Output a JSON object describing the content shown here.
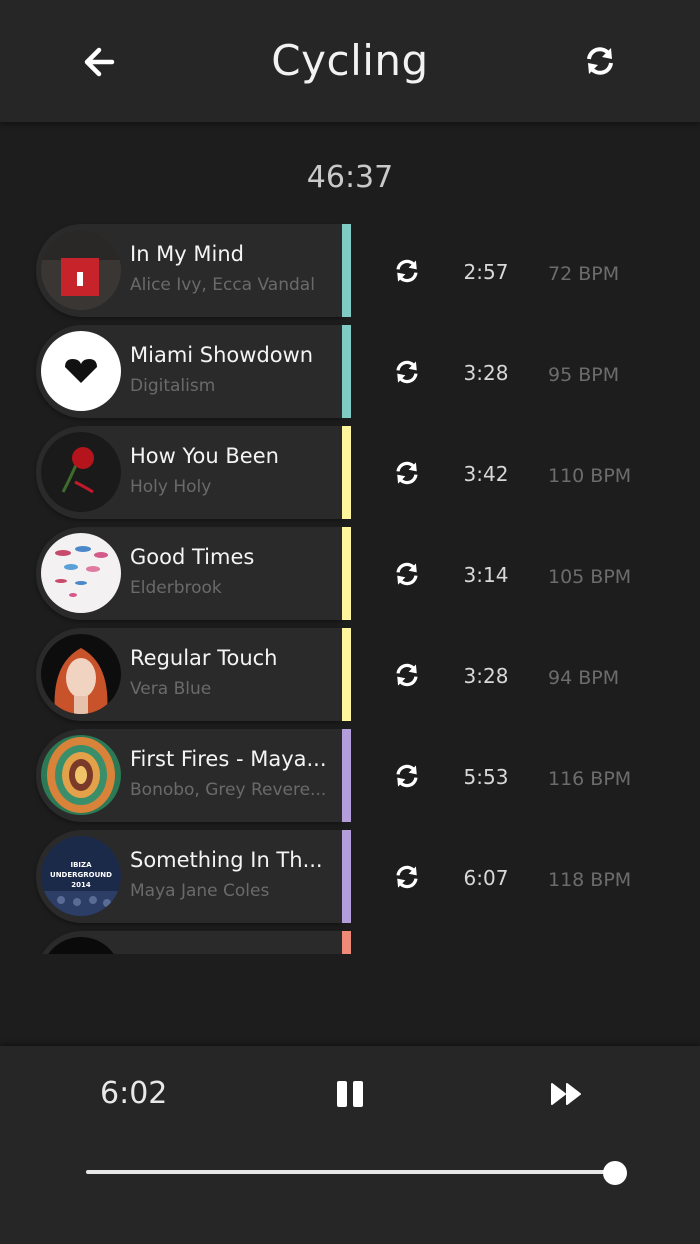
{
  "header": {
    "title": "Cycling"
  },
  "total_time": "46:37",
  "songs": [
    {
      "title": "In My Mind",
      "artist": "Alice Ivy, Ecca Vandal",
      "duration": "2:57",
      "bpm": "72 BPM",
      "bar_color": "#80cbc4",
      "art": "red-square-cover"
    },
    {
      "title": "Miami Showdown",
      "artist": "Digitalism",
      "duration": "3:28",
      "bpm": "95 BPM",
      "bar_color": "#80cbc4",
      "art": "black-heart-cover"
    },
    {
      "title": "How You Been",
      "artist": "Holy Holy",
      "duration": "3:42",
      "bpm": "110 BPM",
      "bar_color": "#fff59d",
      "art": "rose-cover"
    },
    {
      "title": "Good Times",
      "artist": "Elderbrook",
      "duration": "3:14",
      "bpm": "105 BPM",
      "bar_color": "#fff59d",
      "art": "lips-cover"
    },
    {
      "title": "Regular Touch",
      "artist": "Vera Blue",
      "duration": "3:28",
      "bpm": "94 BPM",
      "bar_color": "#fff59d",
      "art": "portrait-cover"
    },
    {
      "title": "First Fires - Maya...",
      "artist": "Bonobo, Grey Revere...",
      "duration": "5:53",
      "bpm": "116 BPM",
      "bar_color": "#b39ddb",
      "art": "tunnel-cover"
    },
    {
      "title": "Something In Th...",
      "artist": "Maya Jane Coles",
      "duration": "6:07",
      "bpm": "118 BPM",
      "bar_color": "#b39ddb",
      "art": "ibiza-underground-cover"
    },
    {
      "title": "",
      "artist": "",
      "duration": "",
      "bpm": "",
      "bar_color": "#ef8a78",
      "art": "dark-cover"
    }
  ],
  "ibiza_cover_text": [
    "IBIZA",
    "UNDERGROUND",
    "2014"
  ],
  "player": {
    "elapsed": "6:02",
    "progress": 1.0
  },
  "colors": {
    "background": "#1d1d1d",
    "header": "#262626",
    "card": "#2a2a2a",
    "teal": "#80cbc4",
    "yellow": "#fff59d",
    "purple": "#b39ddb",
    "coral": "#ef8a78"
  },
  "icons": [
    "back-arrow-icon",
    "refresh-icon",
    "swap-icon",
    "pause-icon",
    "fast-forward-icon"
  ]
}
